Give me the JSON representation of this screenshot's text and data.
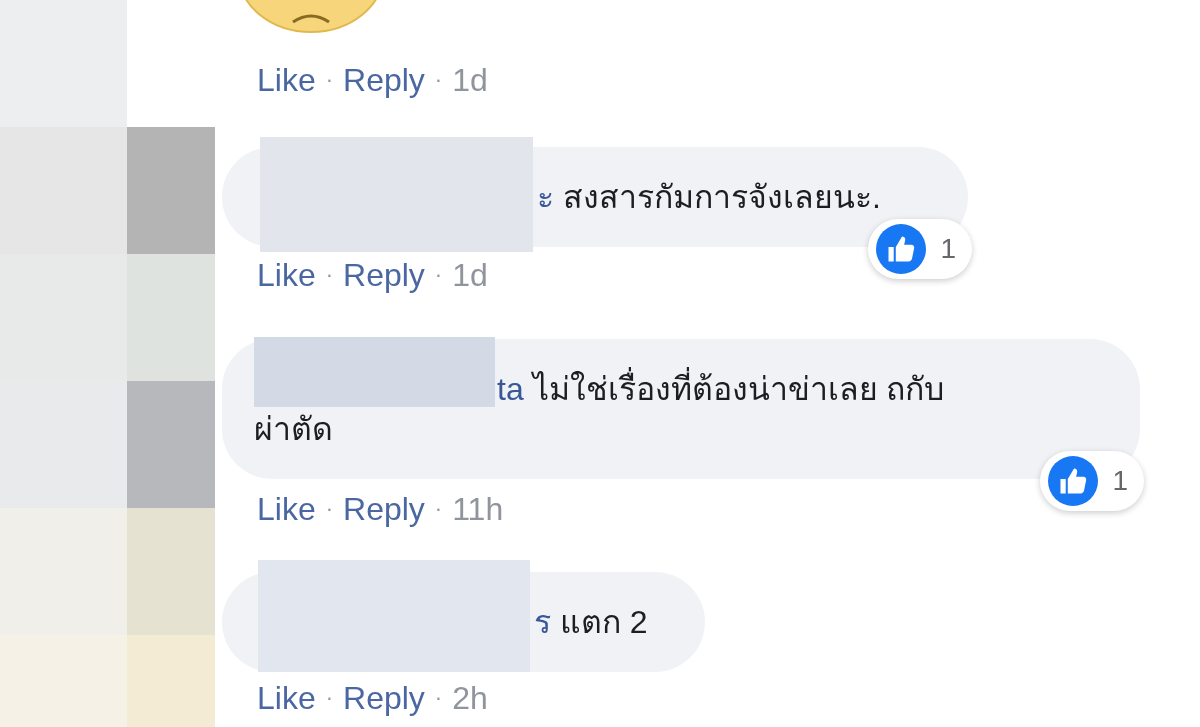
{
  "mosaic": [
    {
      "color": "#eceef0"
    },
    {
      "color": "#ffffff"
    },
    {
      "color": "#e6e6e6"
    },
    {
      "color": "#b4b4b4"
    },
    {
      "color": "#e8eae9"
    },
    {
      "color": "#dfe3df"
    },
    {
      "color": "#e9eaec"
    },
    {
      "color": "#b7b8bc"
    },
    {
      "color": "#f1efea"
    },
    {
      "color": "#e6e2d2"
    },
    {
      "color": "#f5f1e6"
    },
    {
      "color": "#f4ebd4"
    }
  ],
  "comments": [
    {
      "kind": "sticker",
      "actions": [
        "Like",
        "Reply"
      ],
      "separator": "·",
      "time": "1d"
    },
    {
      "kind": "text",
      "name": "ะ",
      "text": "สงสารกัมการจังเลยนะ.",
      "reactions": "1",
      "redacted": true,
      "actions": [
        "Like",
        "Reply"
      ],
      "separator": "·",
      "time": "1d"
    },
    {
      "kind": "text",
      "name": "ta",
      "text": "ไม่ใช่เรื่องที่ต้องน่าข่าเลย ถกับ\nผ่าตัด",
      "reactions": "1",
      "redacted": true,
      "actions": [
        "Like",
        "Reply"
      ],
      "separator": "·",
      "time": "11h"
    },
    {
      "kind": "text",
      "name": "ร",
      "text": "แตก 2",
      "redacted": true,
      "actions": [
        "Like",
        "Reply"
      ],
      "separator": "·",
      "time": "2h"
    }
  ]
}
